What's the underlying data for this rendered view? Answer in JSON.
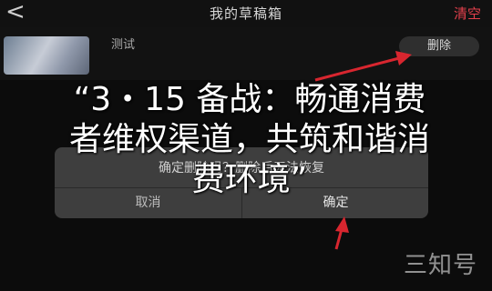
{
  "header": {
    "back_icon": "chevron-left-icon",
    "title": "我的草稿箱",
    "clear_label": "清空"
  },
  "draft": {
    "label": "测试",
    "delete_label": "删除"
  },
  "dialog": {
    "message": "确定删除吗？删除后无法恢复",
    "cancel_label": "取消",
    "confirm_label": "确定"
  },
  "overlay": {
    "headline_line1": "“3・15 备战：畅通消费",
    "headline_line2": "者维权渠道，共筑和谐消",
    "headline_line3": "费环境”",
    "watermark": "三知号"
  },
  "colors": {
    "accent_red": "#e2404c",
    "annotation_red": "#d8262f"
  }
}
